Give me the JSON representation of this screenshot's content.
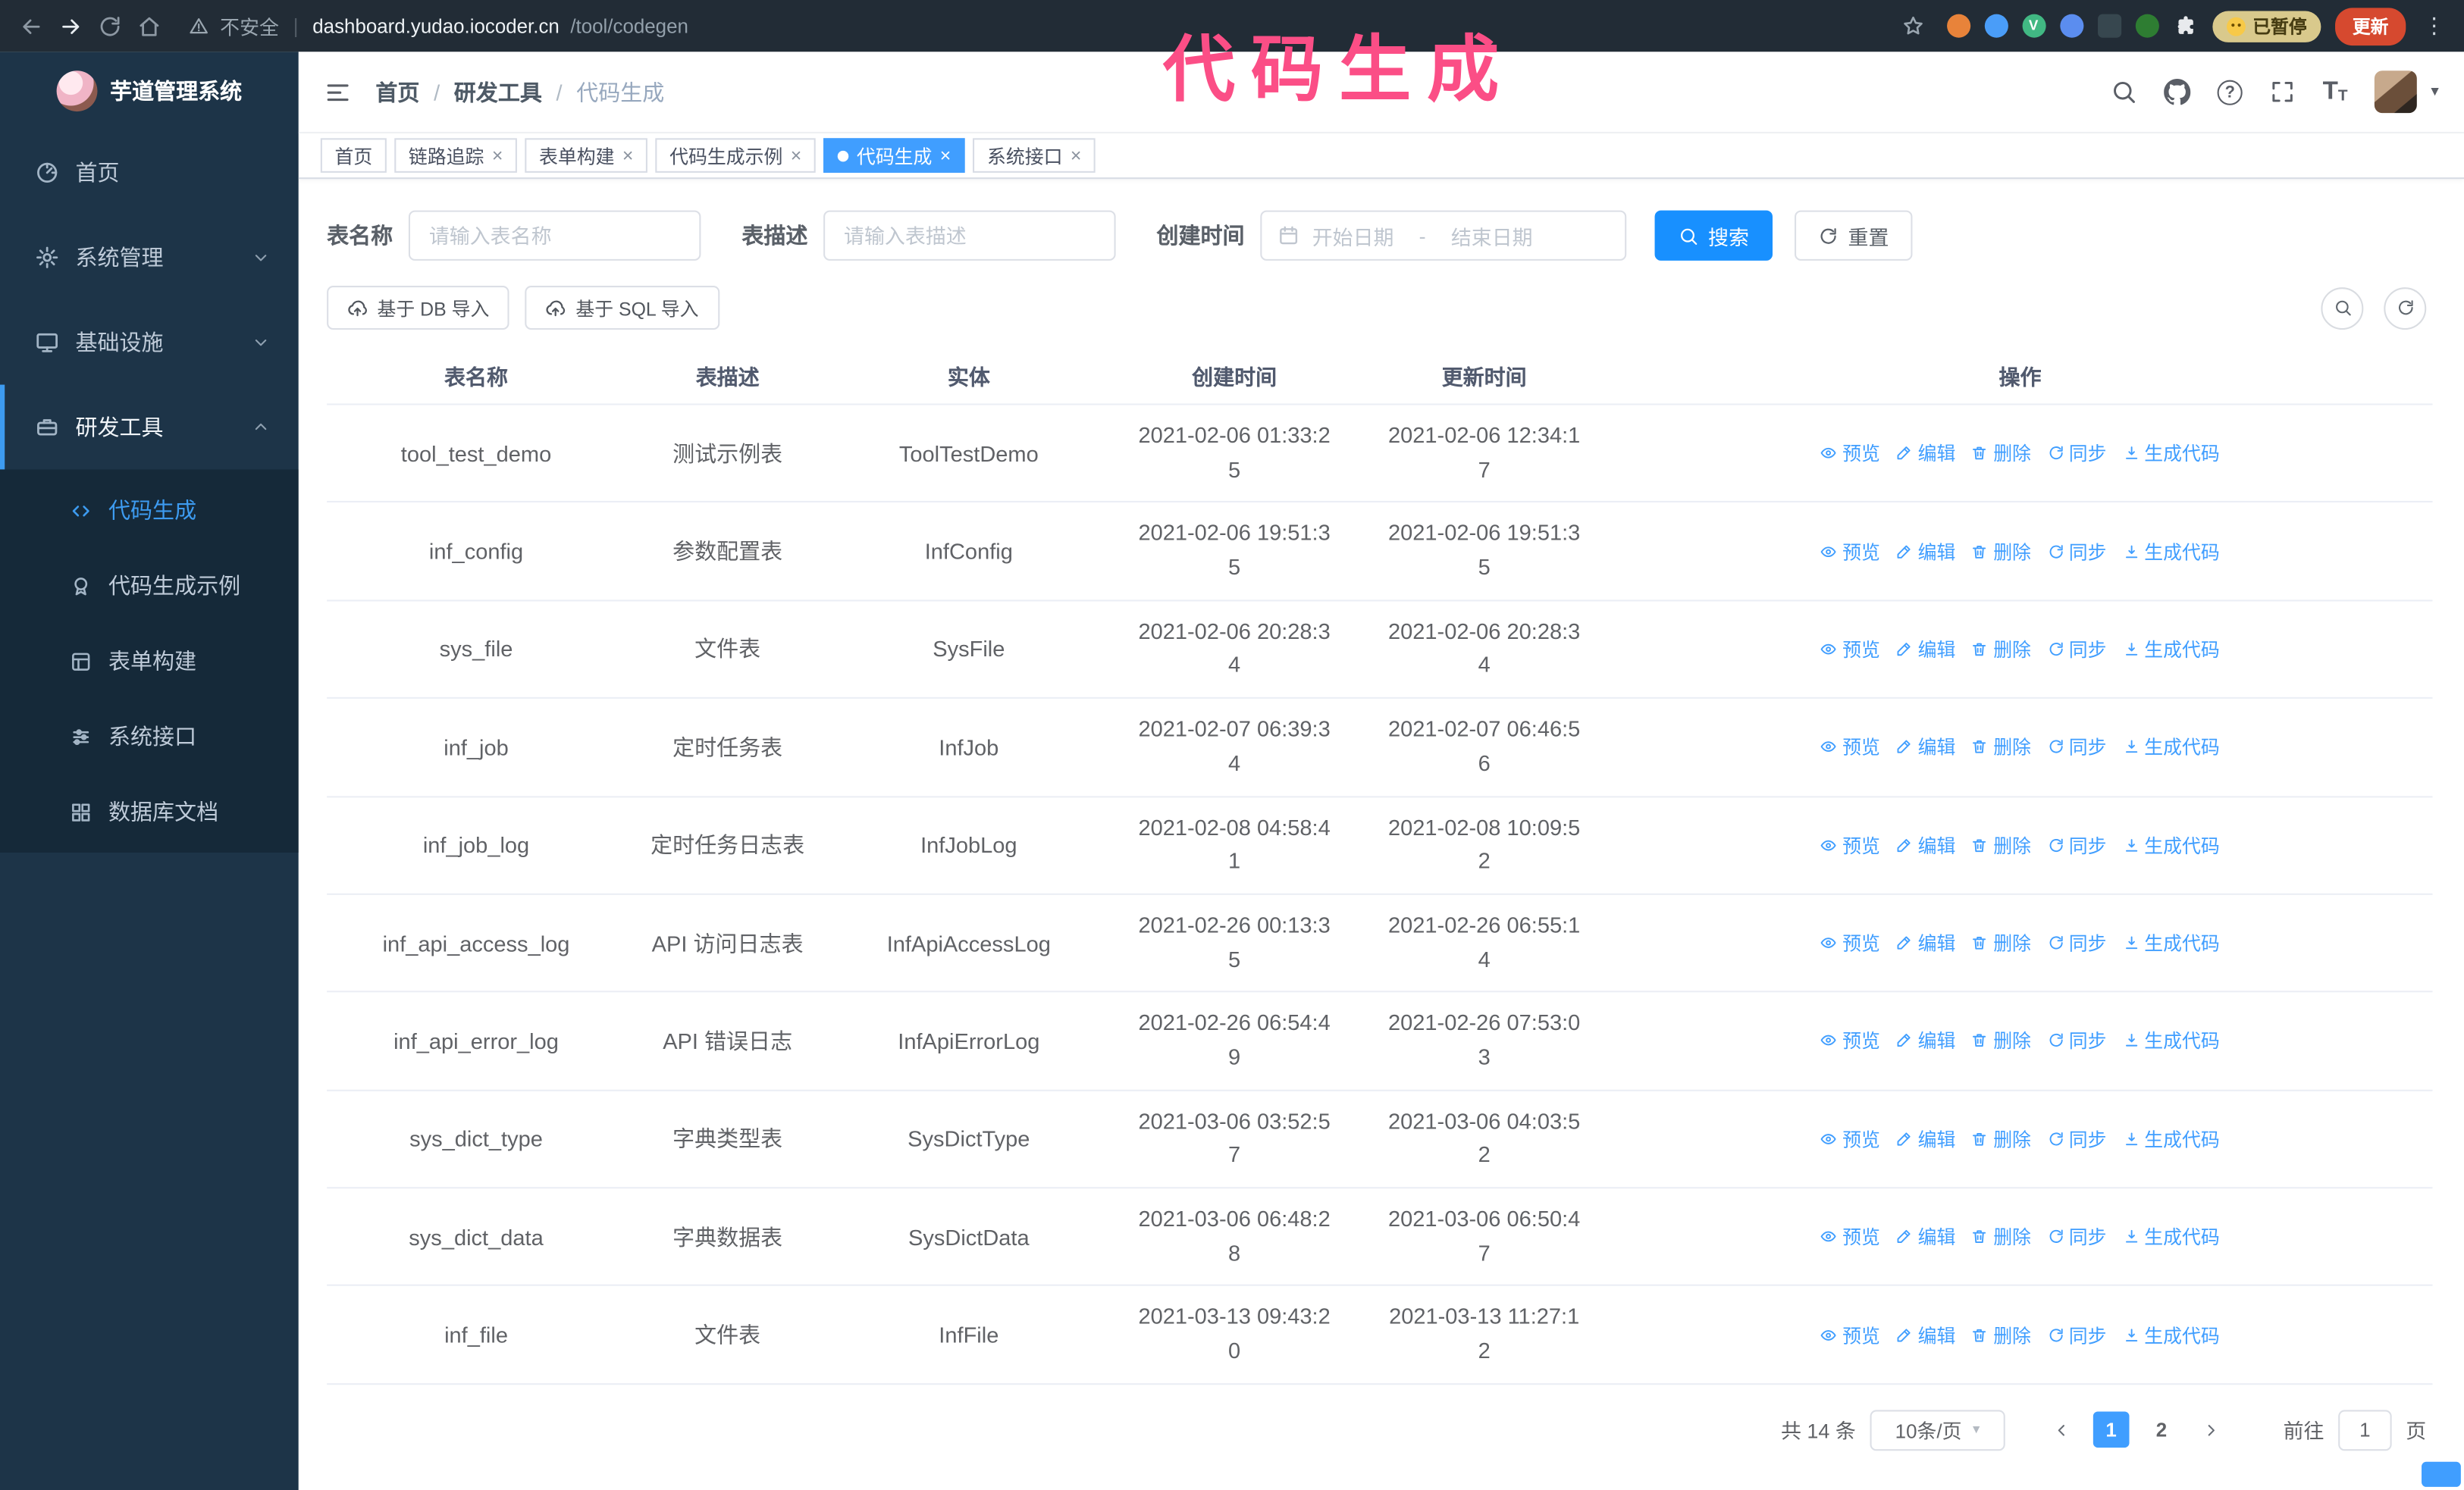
{
  "colors": {
    "accent_blue": "#409eff",
    "search_button_blue": "#1890ff",
    "sidebar_bg": "#1d3448",
    "submenu_bg": "#152939",
    "annotation_pink": "#fb4e86",
    "update_button_red": "#d6492f",
    "browser_chrome_bg": "#222c36"
  },
  "browser": {
    "security_label": "不安全",
    "url_domain": "dashboard.yudao.iocoder.cn",
    "url_path": "/tool/codegen",
    "paused_badge": "已暂停",
    "update_button": "更新"
  },
  "annotation": {
    "title": "代码生成"
  },
  "sidebar": {
    "logo_title": "芋道管理系统",
    "items": [
      {
        "label": "首页"
      },
      {
        "label": "系统管理"
      },
      {
        "label": "基础设施"
      },
      {
        "label": "研发工具"
      }
    ],
    "subitems": [
      {
        "label": "代码生成",
        "active": true
      },
      {
        "label": "代码生成示例"
      },
      {
        "label": "表单构建"
      },
      {
        "label": "系统接口"
      },
      {
        "label": "数据库文档"
      }
    ]
  },
  "header": {
    "breadcrumb": [
      "首页",
      "研发工具",
      "代码生成"
    ]
  },
  "tabs": [
    {
      "label": "首页",
      "closable": false,
      "active": false
    },
    {
      "label": "链路追踪",
      "closable": true,
      "active": false
    },
    {
      "label": "表单构建",
      "closable": true,
      "active": false
    },
    {
      "label": "代码生成示例",
      "closable": true,
      "active": false
    },
    {
      "label": "代码生成",
      "closable": true,
      "active": true
    },
    {
      "label": "系统接口",
      "closable": true,
      "active": false
    }
  ],
  "filters": {
    "table_name_label": "表名称",
    "table_name_placeholder": "请输入表名称",
    "table_desc_label": "表描述",
    "table_desc_placeholder": "请输入表描述",
    "create_time_label": "创建时间",
    "date_start_placeholder": "开始日期",
    "date_separator": "-",
    "date_end_placeholder": "结束日期",
    "search_button": "搜索",
    "reset_button": "重置"
  },
  "toolbar": {
    "import_db_button": "基于 DB 导入",
    "import_sql_button": "基于 SQL 导入"
  },
  "table": {
    "columns": [
      "表名称",
      "表描述",
      "实体",
      "创建时间",
      "更新时间",
      "操作"
    ],
    "actions": [
      "预览",
      "编辑",
      "删除",
      "同步",
      "生成代码"
    ],
    "rows": [
      {
        "name": "tool_test_demo",
        "desc": "测试示例表",
        "entity": "ToolTestDemo",
        "created": "2021-02-06 01:33:25",
        "updated": "2021-02-06 12:34:17"
      },
      {
        "name": "inf_config",
        "desc": "参数配置表",
        "entity": "InfConfig",
        "created": "2021-02-06 19:51:35",
        "updated": "2021-02-06 19:51:35"
      },
      {
        "name": "sys_file",
        "desc": "文件表",
        "entity": "SysFile",
        "created": "2021-02-06 20:28:34",
        "updated": "2021-02-06 20:28:34"
      },
      {
        "name": "inf_job",
        "desc": "定时任务表",
        "entity": "InfJob",
        "created": "2021-02-07 06:39:34",
        "updated": "2021-02-07 06:46:56"
      },
      {
        "name": "inf_job_log",
        "desc": "定时任务日志表",
        "entity": "InfJobLog",
        "created": "2021-02-08 04:58:41",
        "updated": "2021-02-08 10:09:52"
      },
      {
        "name": "inf_api_access_log",
        "desc": "API 访问日志表",
        "entity": "InfApiAccessLog",
        "created": "2021-02-26 00:13:35",
        "updated": "2021-02-26 06:55:14"
      },
      {
        "name": "inf_api_error_log",
        "desc": "API 错误日志",
        "entity": "InfApiErrorLog",
        "created": "2021-02-26 06:54:49",
        "updated": "2021-02-26 07:53:03"
      },
      {
        "name": "sys_dict_type",
        "desc": "字典类型表",
        "entity": "SysDictType",
        "created": "2021-03-06 03:52:57",
        "updated": "2021-03-06 04:03:52"
      },
      {
        "name": "sys_dict_data",
        "desc": "字典数据表",
        "entity": "SysDictData",
        "created": "2021-03-06 06:48:28",
        "updated": "2021-03-06 06:50:47"
      },
      {
        "name": "inf_file",
        "desc": "文件表",
        "entity": "InfFile",
        "created": "2021-03-13 09:43:20",
        "updated": "2021-03-13 11:27:12"
      }
    ]
  },
  "pagination": {
    "total": "共 14 条",
    "page_size": "10条/页",
    "pages": [
      "1",
      "2"
    ],
    "goto_label": "前往",
    "goto_value": "1",
    "goto_suffix": "页"
  },
  "icons": {
    "close_x": "×",
    "caret_down": "▾",
    "breadcrumb_separator": "/",
    "url_divider": "|",
    "question_mark": "?",
    "font_size_big": "T",
    "font_size_small": "T",
    "kebab_menu": "⋮",
    "vue_devtools_letter": "V"
  }
}
